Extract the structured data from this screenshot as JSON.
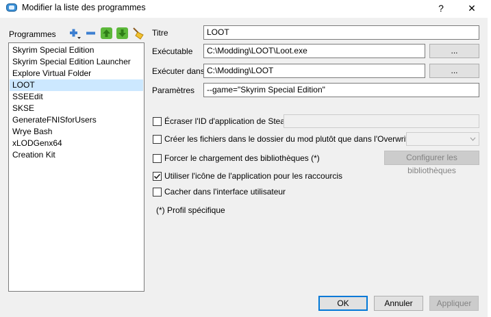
{
  "window": {
    "title": "Modifier la liste des programmes",
    "help_label": "?",
    "close_label": "✕"
  },
  "left": {
    "programs_label": "Programmes",
    "items": [
      {
        "label": "Skyrim Special Edition"
      },
      {
        "label": "Skyrim Special Edition Launcher"
      },
      {
        "label": "Explore Virtual Folder"
      },
      {
        "label": "LOOT",
        "selected": true
      },
      {
        "label": "SSEEdit"
      },
      {
        "label": "SKSE"
      },
      {
        "label": "GenerateFNISforUsers"
      },
      {
        "label": "Wrye Bash"
      },
      {
        "label": "xLODGenx64"
      },
      {
        "label": "Creation Kit"
      }
    ]
  },
  "form": {
    "title_label": "Titre",
    "title_value": "LOOT",
    "exe_label": "Exécutable",
    "exe_value": "C:\\Modding\\LOOT\\Loot.exe",
    "browse_label": "...",
    "run_in_label": "Exécuter dans",
    "run_in_value": "C:\\Modding\\LOOT",
    "params_label": "Paramètres",
    "params_value": "--game=\"Skyrim Special Edition\""
  },
  "options": {
    "steam_id_label": "Écraser l'ID d'application de Steam",
    "create_files_label": "Créer les fichiers dans le dossier du mod plutôt que dans l'Overwrite (*)",
    "force_libs_label": "Forcer le chargement des bibliothèques (*)",
    "configure_libs_label": "Configurer les bibliothèques",
    "use_icon_label": "Utiliser l'icône de l'application pour les raccourcis",
    "use_icon_checked": true,
    "hide_ui_label": "Cacher dans l'interface utilisateur",
    "profile_note": "(*) Profil spécifique"
  },
  "footer": {
    "ok_label": "OK",
    "cancel_label": "Annuler",
    "apply_label": "Appliquer"
  },
  "colors": {
    "selection": "#cce8ff",
    "dialog_bg": "#f0f0f0",
    "ok_border": "#0078d7"
  }
}
